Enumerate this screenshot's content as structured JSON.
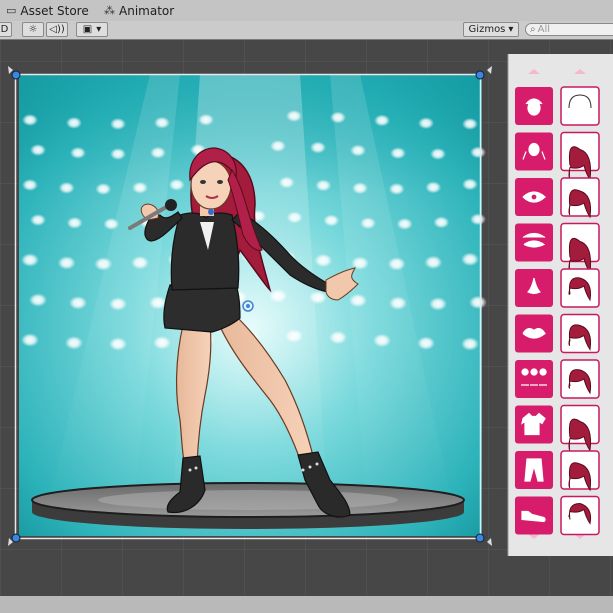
{
  "tabs": {
    "asset_store": "Asset Store",
    "animator": "Animator"
  },
  "toolbar": {
    "mode_label": "D",
    "light_icon": "sun-icon",
    "audio_icon": "speaker-icon",
    "effects_icon": "image-icon",
    "effects_dropdown": "▾",
    "gizmos_label": "Gizmos",
    "gizmos_dropdown": "▾",
    "search_placeholder": "All",
    "search_prefix": "Q▾"
  },
  "editor": {
    "colors": {
      "category_button": "#d61c6a",
      "option_border": "#c8185e",
      "hair_color": "#a41c3c",
      "stage_bg": "#2bb9c0",
      "panel_bg": "#e6e6e6"
    },
    "categories": [
      {
        "name": "face-shape",
        "icon": "head-icon"
      },
      {
        "name": "hair-back",
        "icon": "ponytail-icon"
      },
      {
        "name": "eyes",
        "icon": "eye-icon"
      },
      {
        "name": "eyebrows",
        "icon": "eyebrow-icon"
      },
      {
        "name": "nose",
        "icon": "nose-icon"
      },
      {
        "name": "mouth",
        "icon": "lips-icon"
      },
      {
        "name": "skin-tone",
        "icon": "people-icon"
      },
      {
        "name": "top",
        "icon": "tshirt-icon"
      },
      {
        "name": "bottom",
        "icon": "pants-icon"
      },
      {
        "name": "shoes",
        "icon": "sneaker-icon"
      }
    ],
    "hair_options": [
      "bald",
      "long-wavy",
      "medium-curly",
      "long-straight",
      "short-messy",
      "bob",
      "short-layered",
      "curly-long",
      "shoulder-length",
      "bun"
    ]
  }
}
